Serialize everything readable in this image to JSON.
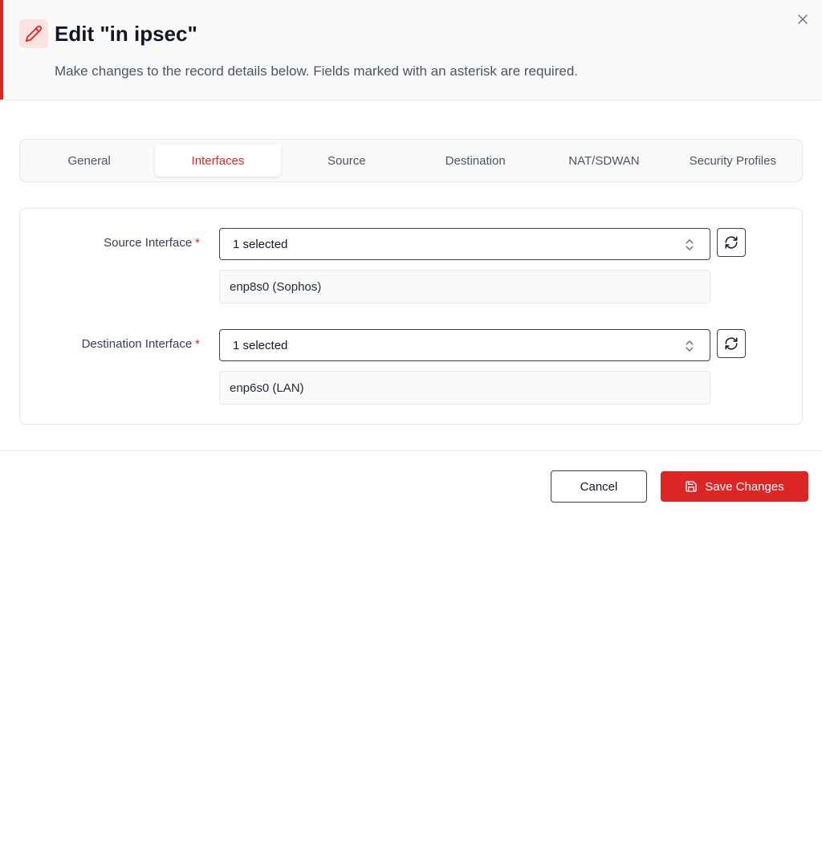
{
  "header": {
    "title": "Edit \"in ipsec\"",
    "subtitle": "Make changes to the record details below. Fields marked with an asterisk are required.",
    "edit_icon": "pencil-icon",
    "close_icon": "close-icon"
  },
  "tabs": [
    {
      "label": "General",
      "active": false
    },
    {
      "label": "Interfaces",
      "active": true
    },
    {
      "label": "Source",
      "active": false
    },
    {
      "label": "Destination",
      "active": false
    },
    {
      "label": "NAT/SDWAN",
      "active": false
    },
    {
      "label": "Security Profiles",
      "active": false
    }
  ],
  "form": {
    "source_interface": {
      "label": "Source Interface",
      "required_mark": "*",
      "select_value": "1 selected",
      "selected_items": [
        "enp8s0 (Sophos)"
      ]
    },
    "destination_interface": {
      "label": "Destination Interface",
      "required_mark": "*",
      "select_value": "1 selected",
      "selected_items": [
        "enp6s0 (LAN)"
      ]
    }
  },
  "footer": {
    "cancel_label": "Cancel",
    "save_label": "Save Changes",
    "save_icon": "save-icon"
  },
  "colors": {
    "accent": "#dc2626",
    "icon_bg": "#fde2e2"
  }
}
